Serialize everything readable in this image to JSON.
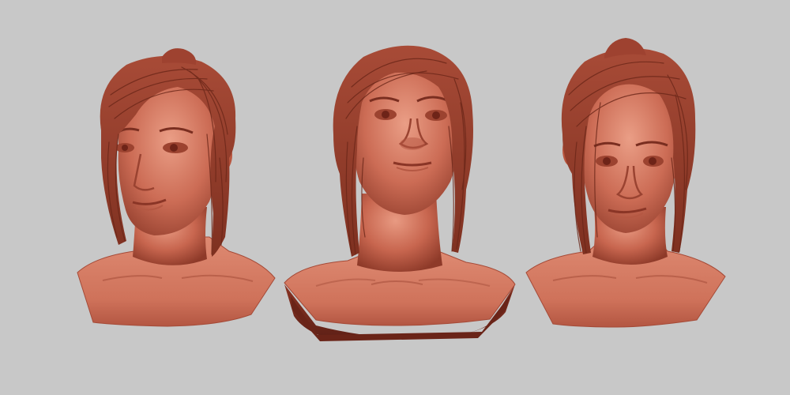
{
  "scene": {
    "background_color": "#c8c8c8",
    "material_color": "#c86a55",
    "material_shadow": "#8c3a2a",
    "material_highlight": "#e0907a",
    "busts": [
      {
        "view": "three-quarter-left"
      },
      {
        "view": "front-low-angle"
      },
      {
        "view": "three-quarter-right"
      }
    ]
  }
}
